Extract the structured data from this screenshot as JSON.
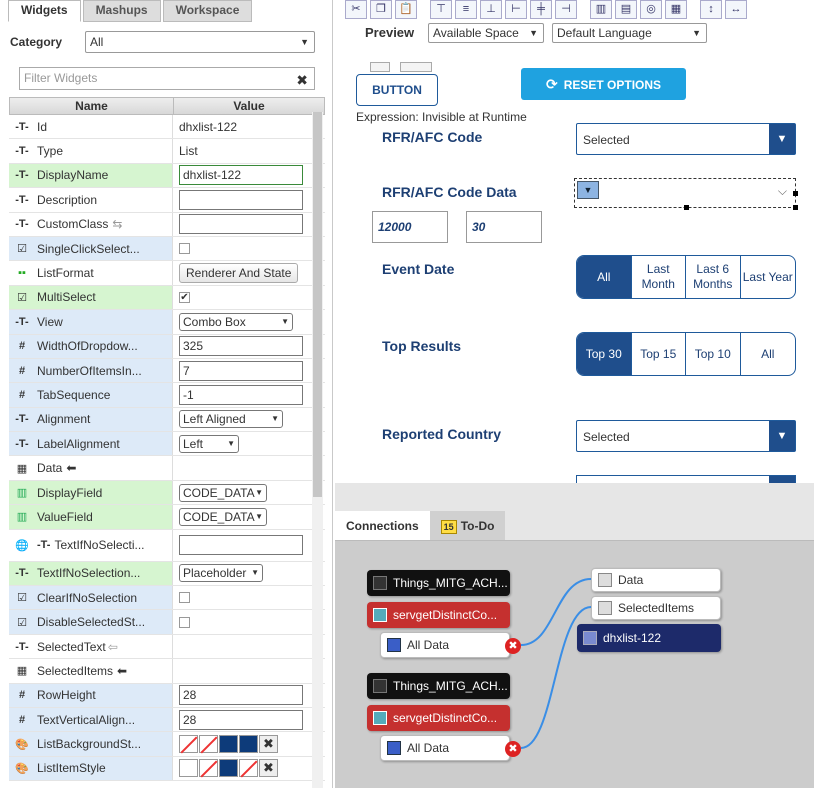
{
  "left_tabs": [
    "Widgets",
    "Mashups",
    "Workspace"
  ],
  "category": {
    "label": "Category",
    "value": "All"
  },
  "filter": {
    "placeholder": "Filter Widgets"
  },
  "grid": {
    "headers": [
      "Name",
      "Value"
    ],
    "rows": [
      {
        "name": "Id",
        "value": "dhxlist-122"
      },
      {
        "name": "Type",
        "value": "List"
      },
      {
        "name": "DisplayName",
        "value": "dhxlist-122"
      },
      {
        "name": "Description",
        "value": ""
      },
      {
        "name": "CustomClass",
        "value": ""
      },
      {
        "name": "SingleClickSelect...",
        "value": ""
      },
      {
        "name": "ListFormat",
        "value": "Renderer And State"
      },
      {
        "name": "MultiSelect",
        "value": "✔"
      },
      {
        "name": "View",
        "value": "Combo Box"
      },
      {
        "name": "WidthOfDropdow...",
        "value": "325"
      },
      {
        "name": "NumberOfItemsIn...",
        "value": "7"
      },
      {
        "name": "TabSequence",
        "value": "-1"
      },
      {
        "name": "Alignment",
        "value": "Left Aligned"
      },
      {
        "name": "LabelAlignment",
        "value": "Left"
      },
      {
        "name": "Data",
        "value": ""
      },
      {
        "name": "DisplayField",
        "value": "CODE_DATA"
      },
      {
        "name": "ValueField",
        "value": "CODE_DATA"
      },
      {
        "name": "TextIfNoSelecti...",
        "value": ""
      },
      {
        "name": "TextIfNoSelection...",
        "value": "Placeholder"
      },
      {
        "name": "ClearIfNoSelection",
        "value": ""
      },
      {
        "name": "DisableSelectedSt...",
        "value": ""
      },
      {
        "name": "SelectedText",
        "value": ""
      },
      {
        "name": "SelectedItems",
        "value": ""
      },
      {
        "name": "RowHeight",
        "value": "28"
      },
      {
        "name": "TextVerticalAlign...",
        "value": "28"
      },
      {
        "name": "ListBackgroundSt...",
        "value": ""
      },
      {
        "name": "ListItemStyle",
        "value": ""
      }
    ]
  },
  "toolbar": {
    "preview": "Preview",
    "space": "Available Space",
    "language": "Default Language"
  },
  "canvas": {
    "button": "BUTTON",
    "reset": "RESET OPTIONS",
    "expression": "Expression: Invisible at Runtime",
    "rfr_code": {
      "label": "RFR/AFC Code",
      "value": "Selected"
    },
    "rfr_code_data": {
      "label": "RFR/AFC Code Data"
    },
    "num1": "12000",
    "num2": "30",
    "event_date": {
      "label": "Event Date",
      "options": [
        "All",
        "Last Month",
        "Last 6 Months",
        "Last Year"
      ]
    },
    "top_results": {
      "label": "Top Results",
      "options": [
        "Top 30",
        "Top 15",
        "Top 10",
        "All"
      ]
    },
    "country": {
      "label": "Reported Country",
      "value": "Selected"
    }
  },
  "bottom": {
    "tabs": [
      "Connections",
      "To-Do"
    ],
    "todo_badge": "15",
    "nodes": {
      "things1": "Things_MITG_ACH...",
      "serv1": "servgetDistinctCo...",
      "all1": "All Data",
      "things2": "Things_MITG_ACH...",
      "serv2": "servgetDistinctCo...",
      "all2": "All Data",
      "data": "Data",
      "selected": "SelectedItems",
      "list": "dhxlist-122"
    }
  },
  "colors": {
    "accent": "#1fa2e0",
    "navy": "#1f4e8c",
    "green_row": "#d6f5d0",
    "blue_row": "#ddeaf8"
  }
}
